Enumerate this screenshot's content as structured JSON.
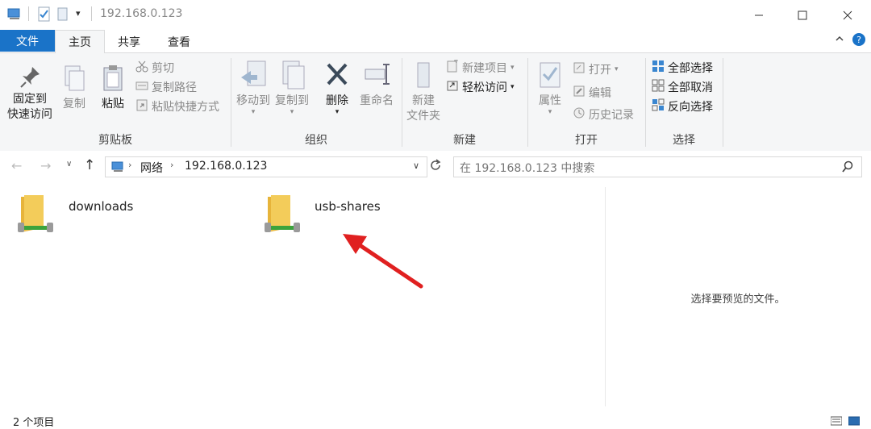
{
  "titlebar": {
    "title": "192.168.0.123",
    "quick_access": [
      "computer-icon",
      "properties-check-icon",
      "new-folder-icon",
      "customize-dropdown-icon"
    ],
    "controls": [
      "minimize",
      "maximize",
      "close"
    ]
  },
  "tabs": {
    "file": "文件",
    "home": "主页",
    "share": "共享",
    "view": "查看"
  },
  "ribbon": {
    "clipboard": {
      "label": "剪贴板",
      "pin_line1": "固定到",
      "pin_line2": "快速访问",
      "copy": "复制",
      "paste": "粘贴",
      "cut": "剪切",
      "copy_path": "复制路径",
      "paste_shortcut": "粘贴快捷方式"
    },
    "organize": {
      "label": "组织",
      "move_to": "移动到",
      "copy_to": "复制到",
      "delete": "删除",
      "rename": "重命名"
    },
    "new": {
      "label": "新建",
      "new_folder_line1": "新建",
      "new_folder_line2": "文件夹",
      "new_item": "新建项目",
      "easy_access": "轻松访问"
    },
    "open": {
      "label": "打开",
      "properties": "属性",
      "open": "打开",
      "edit": "编辑",
      "history": "历史记录"
    },
    "select": {
      "label": "选择",
      "select_all": "全部选择",
      "select_none": "全部取消",
      "invert": "反向选择"
    }
  },
  "address": {
    "crumb_network": "网络",
    "crumb_host": "192.168.0.123",
    "search_placeholder": "在 192.168.0.123 中搜索"
  },
  "folders": [
    {
      "name": "downloads"
    },
    {
      "name": "usb-shares"
    }
  ],
  "preview": {
    "message": "选择要预览的文件。"
  },
  "status": {
    "count": "2 个项目"
  },
  "colors": {
    "file_tab": "#1a73c8",
    "folder": "#f3cc5a",
    "network_green": "#3ca33c",
    "arrow": "#e02020"
  }
}
